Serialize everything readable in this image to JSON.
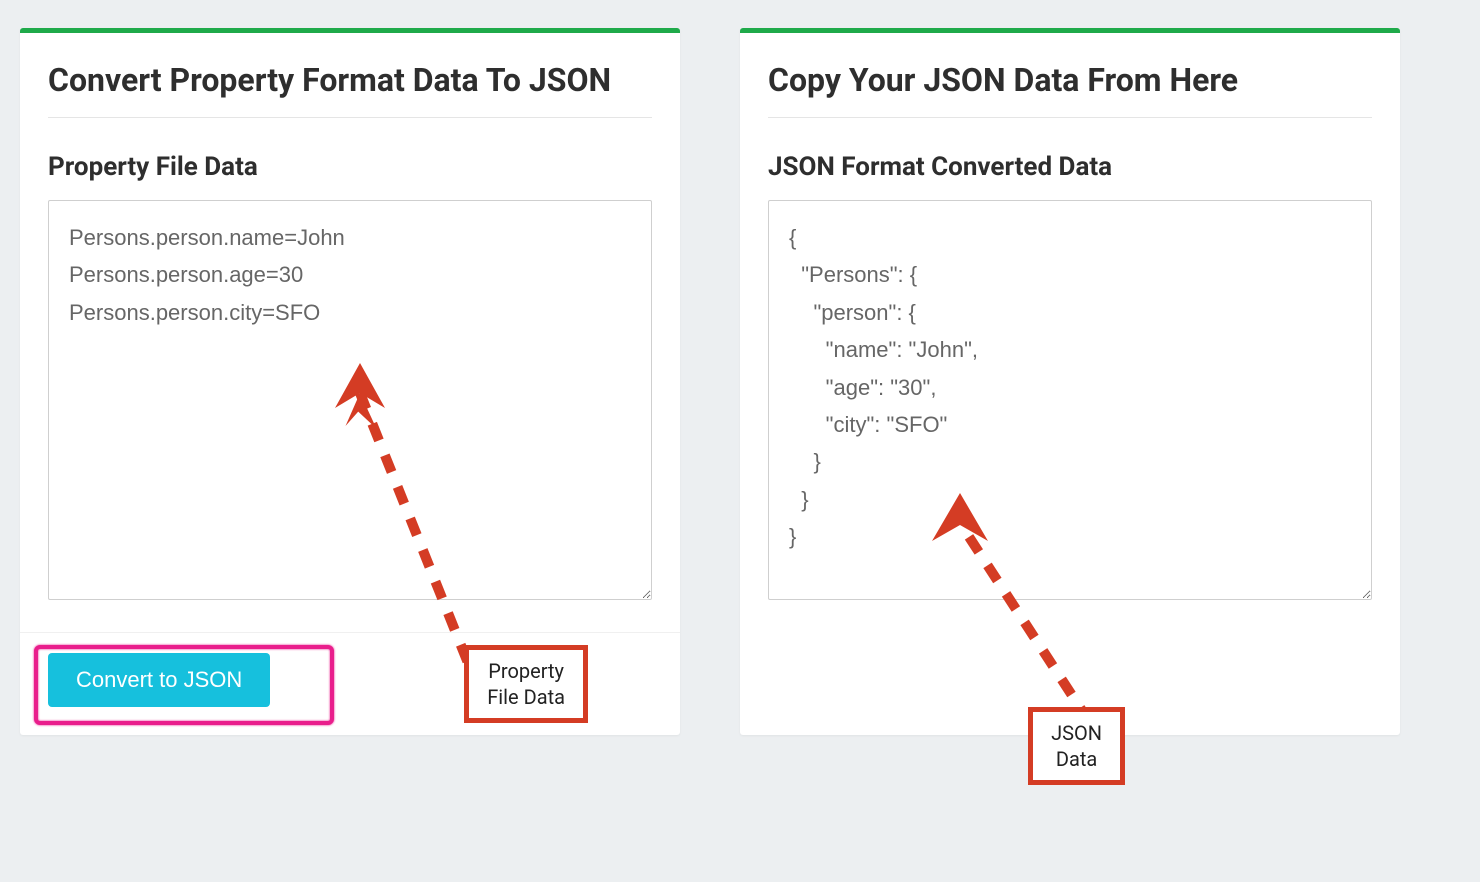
{
  "left_panel": {
    "title": "Convert Property Format Data To JSON",
    "section_label": "Property File Data",
    "textarea_value": "Persons.person.name=John\nPersons.person.age=30\nPersons.person.city=SFO",
    "convert_button": "Convert to JSON",
    "annotation": "Property\nFile Data"
  },
  "right_panel": {
    "title": "Copy Your JSON Data From Here",
    "section_label": "JSON Format Converted Data",
    "textarea_value": "{\n  \"Persons\": {\n    \"person\": {\n      \"name\": \"John\",\n      \"age\": \"30\",\n      \"city\": \"SFO\"\n    }\n  }\n}",
    "annotation": "JSON\nData"
  },
  "colors": {
    "accent_green": "#1faa4a",
    "button_teal": "#16c0dd",
    "highlight_pink": "#e91e8c",
    "annotation_red": "#d43c24"
  }
}
